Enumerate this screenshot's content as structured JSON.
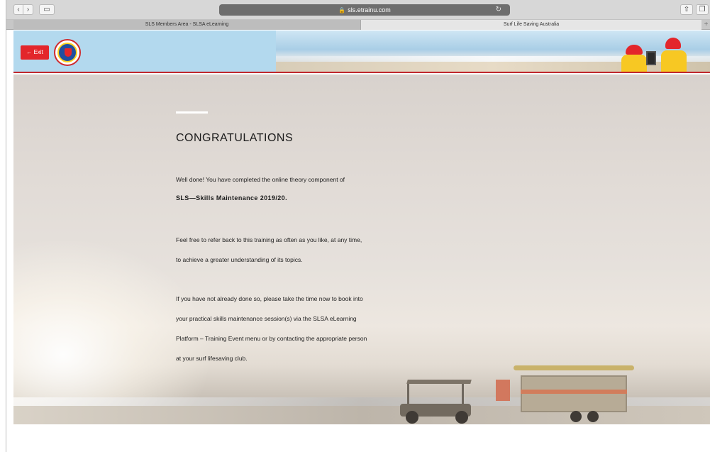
{
  "browser": {
    "url": "sls.etrainu.com",
    "tabs": [
      {
        "label": "SLS Members Area - SLSA eLearning",
        "active": false
      },
      {
        "label": "Surf Life Saving Australia",
        "active": true
      }
    ]
  },
  "header": {
    "exit_label": "← Exit",
    "logo_icon": "surf-life-saving-logo"
  },
  "main": {
    "title": "CONGRATULATIONS",
    "intro": "Well done! You have completed the online theory component of",
    "course_name": "SLS—Skills Maintenance 2019/20.",
    "para2_line1": "Feel free to refer back to this training as often as you like, at any time,",
    "para2_line2": "to achieve a greater understanding of its topics.",
    "para3_line1": "If you have not already done so, please take the time now to book into",
    "para3_line2": "your practical skills maintenance session(s) via the SLSA eLearning",
    "para3_line3": "Platform – Training Event menu or by contacting the appropriate person",
    "para3_line4": "at your surf lifesaving club."
  },
  "colors": {
    "accent": "#e3262b",
    "header_sky": "#b3d9ee"
  }
}
